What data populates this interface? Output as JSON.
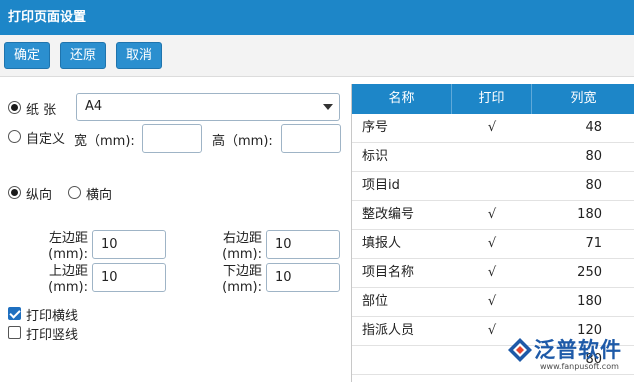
{
  "title": "打印页面设置",
  "toolbar": {
    "confirm": "确定",
    "restore": "还原",
    "cancel": "取消"
  },
  "paper": {
    "paper_label": "纸 张",
    "paper_value": "A4",
    "custom_label": "自定义",
    "width_label": "宽（mm):",
    "width_value": "",
    "height_label": "高（mm):",
    "height_value": ""
  },
  "orientation": {
    "portrait": "纵向",
    "landscape": "横向",
    "selected": "portrait"
  },
  "margins": {
    "left_label_1": "左边距",
    "left_label_2": "(mm):",
    "left_value": "10",
    "right_label_1": "右边距",
    "right_label_2": "(mm):",
    "right_value": "10",
    "top_label_1": "上边距",
    "top_label_2": "(mm):",
    "top_value": "10",
    "bottom_label_1": "下边距",
    "bottom_label_2": "(mm):",
    "bottom_value": "10"
  },
  "options": {
    "print_hlines": "打印横线",
    "print_hlines_checked": true,
    "print_vlines": "打印竖线",
    "print_vlines_checked": false
  },
  "grid": {
    "headers": [
      "名称",
      "打印",
      "列宽"
    ],
    "rows": [
      {
        "name": "序号",
        "print": "√",
        "width": "48"
      },
      {
        "name": "标识",
        "print": "",
        "width": "80"
      },
      {
        "name": "项目id",
        "print": "",
        "width": "80"
      },
      {
        "name": "整改编号",
        "print": "√",
        "width": "180"
      },
      {
        "name": "填报人",
        "print": "√",
        "width": "71"
      },
      {
        "name": "项目名称",
        "print": "√",
        "width": "250"
      },
      {
        "name": "部位",
        "print": "√",
        "width": "180"
      },
      {
        "name": "指派人员",
        "print": "√",
        "width": "120"
      },
      {
        "name": "",
        "print": "",
        "width": "80"
      }
    ]
  },
  "watermark": {
    "brand": "泛普软件",
    "url": "www.fanpusoft.com"
  },
  "colors": {
    "header_blue": "#1d86c8",
    "button_blue": "#2b8fcf"
  }
}
